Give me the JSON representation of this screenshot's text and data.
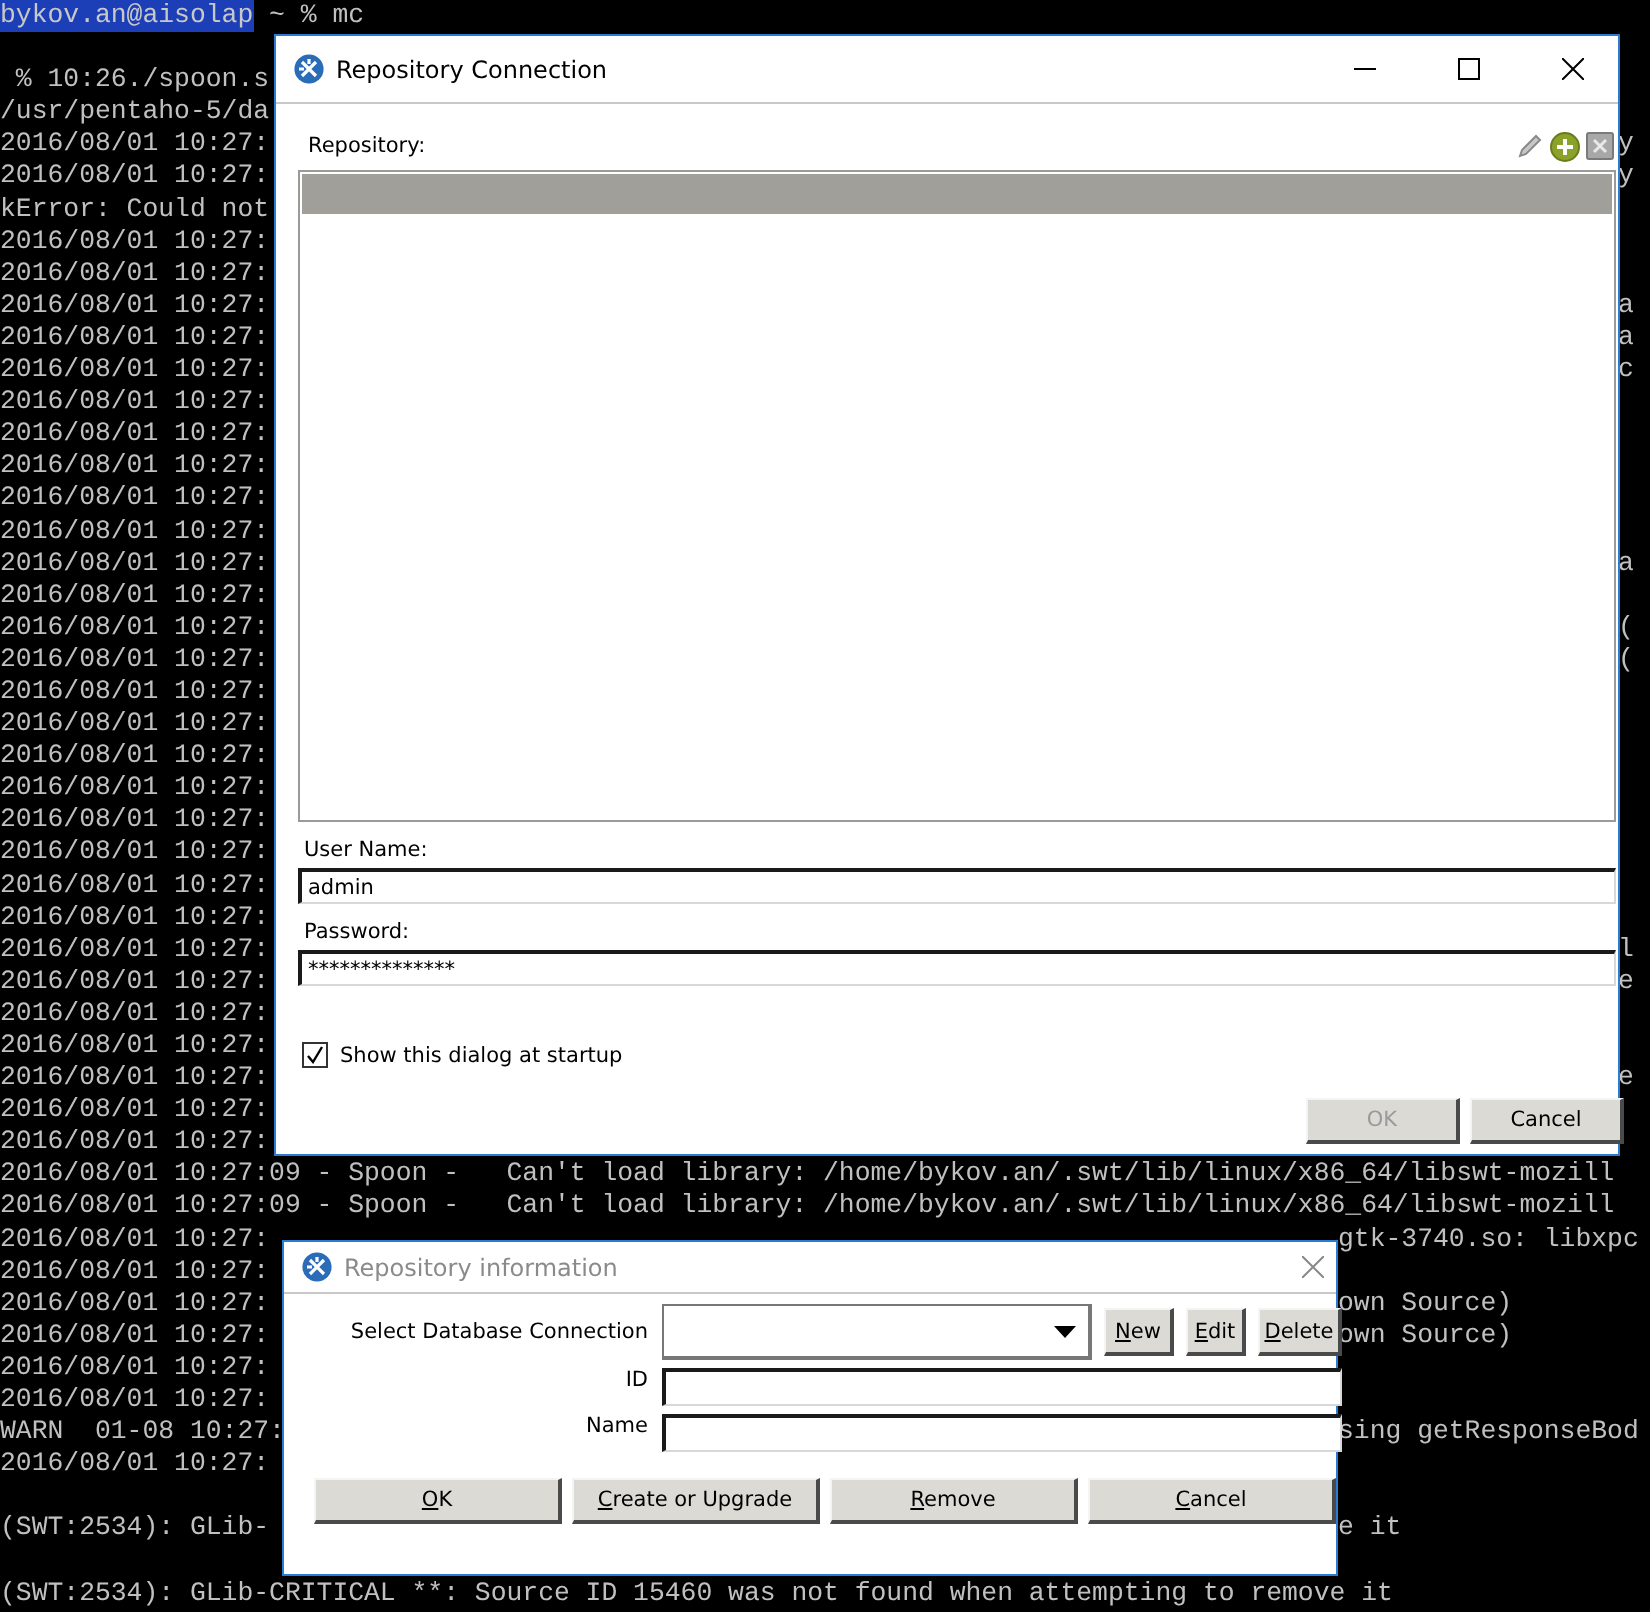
{
  "terminal": {
    "lines": [
      {
        "kind": "prompt",
        "user": "bykov.an@aisolap",
        "text": " ~ % mc"
      },
      {
        "kind": "blank"
      },
      {
        "kind": "text",
        "text": " % 10:26./spoon.s"
      },
      {
        "kind": "text",
        "text": "/usr/pentaho-5/da"
      },
      {
        "kind": "text",
        "text": "2016/08/01 10:27:",
        "right": "y"
      },
      {
        "kind": "text",
        "text": "2016/08/01 10:27:",
        "right": "y"
      },
      {
        "kind": "text",
        "text": "kError: Could not"
      },
      {
        "kind": "text",
        "text": "2016/08/01 10:27:"
      },
      {
        "kind": "text",
        "text": "2016/08/01 10:27:"
      },
      {
        "kind": "text",
        "text": "2016/08/01 10:27:",
        "right": "a"
      },
      {
        "kind": "text",
        "text": "2016/08/01 10:27:",
        "right": "a"
      },
      {
        "kind": "text",
        "text": "2016/08/01 10:27:",
        "right": "c"
      },
      {
        "kind": "text",
        "text": "2016/08/01 10:27:"
      },
      {
        "kind": "text",
        "text": "2016/08/01 10:27:"
      },
      {
        "kind": "text",
        "text": "2016/08/01 10:27:"
      },
      {
        "kind": "text",
        "text": "2016/08/01 10:27:"
      },
      {
        "kind": "text",
        "text": "2016/08/01 10:27:"
      },
      {
        "kind": "text",
        "text": "2016/08/01 10:27:",
        "right": "a"
      },
      {
        "kind": "text",
        "text": "2016/08/01 10:27:"
      },
      {
        "kind": "text",
        "text": "2016/08/01 10:27:",
        "right": "("
      },
      {
        "kind": "text",
        "text": "2016/08/01 10:27:",
        "right": "("
      },
      {
        "kind": "text",
        "text": "2016/08/01 10:27:"
      },
      {
        "kind": "text",
        "text": "2016/08/01 10:27:"
      },
      {
        "kind": "text",
        "text": "2016/08/01 10:27:"
      },
      {
        "kind": "text",
        "text": "2016/08/01 10:27:"
      },
      {
        "kind": "text",
        "text": "2016/08/01 10:27:"
      },
      {
        "kind": "text",
        "text": "2016/08/01 10:27:"
      },
      {
        "kind": "text",
        "text": "2016/08/01 10:27:"
      },
      {
        "kind": "text",
        "text": "2016/08/01 10:27:"
      },
      {
        "kind": "text",
        "text": "2016/08/01 10:27:",
        "right": "l"
      },
      {
        "kind": "text",
        "text": "2016/08/01 10:27:",
        "right": "e"
      },
      {
        "kind": "text",
        "text": "2016/08/01 10:27:"
      },
      {
        "kind": "text",
        "text": "2016/08/01 10:27:"
      },
      {
        "kind": "text",
        "text": "2016/08/01 10:27:",
        "right": "e"
      },
      {
        "kind": "text",
        "text": "2016/08/01 10:27:"
      },
      {
        "kind": "text",
        "text": "2016/08/01 10:27:"
      },
      {
        "kind": "text",
        "text": "2016/08/01 10:27:09 - Spoon -   Can't load library: /home/bykov.an/.swt/lib/linux/x86_64/libswt-mozill"
      },
      {
        "kind": "text",
        "text": "2016/08/01 10:27:09 - Spoon -   Can't load library: /home/bykov.an/.swt/lib/linux/x86_64/libswt-mozill"
      }
    ],
    "lower_lines": [
      {
        "kind": "text",
        "text": "2016/08/01 10:27:",
        "right": "gtk-3740.so: libxpc"
      },
      {
        "kind": "text",
        "text": "2016/08/01 10:27:"
      },
      {
        "kind": "text",
        "text": "2016/08/01 10:27:",
        "right": "own Source)"
      },
      {
        "kind": "text",
        "text": "2016/08/01 10:27:",
        "right": "own Source)"
      },
      {
        "kind": "text",
        "text": "2016/08/01 10:27:"
      },
      {
        "kind": "text",
        "text": "2016/08/01 10:27:"
      },
      {
        "kind": "text",
        "text": "WARN  01-08 10:27:",
        "right": "sing getResponseBod"
      },
      {
        "kind": "text",
        "text": "2016/08/01 10:27:"
      },
      {
        "kind": "blank"
      },
      {
        "kind": "text",
        "text": "(SWT:2534): GLib-",
        "right": "e it"
      },
      {
        "kind": "blank"
      },
      {
        "kind": "text",
        "text": "(SWT:2534): GLib-CRITICAL **: Source ID 15460 was not found when attempting to remove it"
      }
    ]
  },
  "connection_dialog": {
    "title": "Repository Connection",
    "active": true,
    "repository_label": "Repository:",
    "user_name_label": "User Name:",
    "user_name": "admin",
    "password_label": "Password:",
    "password": "**************",
    "show_at_startup": {
      "label": "Show this dialog at startup",
      "checked": true
    },
    "buttons": [
      {
        "label": "OK",
        "disabled": true
      },
      {
        "label": "Cancel",
        "disabled": false
      }
    ]
  },
  "info_dialog": {
    "title": "Repository information",
    "active": false,
    "fields": [
      {
        "kind": "combo",
        "label": "Select Database Connection",
        "buttons": [
          {
            "label": "New",
            "mnemonic": true
          },
          {
            "label": "Edit",
            "mnemonic": true
          },
          {
            "label": "Delete",
            "mnemonic": true
          }
        ]
      },
      {
        "kind": "text",
        "label": "ID"
      },
      {
        "kind": "text",
        "label": "Name"
      }
    ],
    "buttons": [
      {
        "label": "OK",
        "mnemonic": true
      },
      {
        "label": "Create or Upgrade",
        "mnemonic": true
      },
      {
        "label": "Remove",
        "mnemonic": true
      },
      {
        "label": "Cancel",
        "mnemonic": true
      }
    ]
  }
}
